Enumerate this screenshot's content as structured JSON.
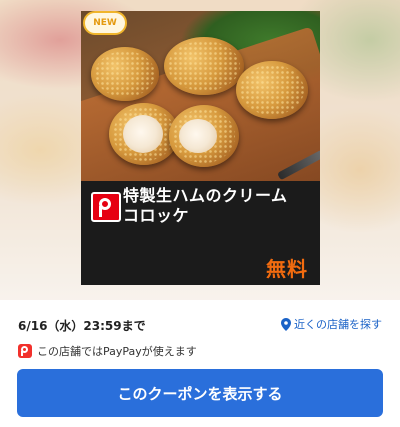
{
  "coupon": {
    "badge": "NEW",
    "title_line1": "特製生ハムのクリーム",
    "title_line2": "コロッケ",
    "price_label": "無料"
  },
  "info": {
    "deadline": "6/16（水）23:59まで",
    "nearby_link": "近くの店舗を探す",
    "paypay_text": "この店舗ではPayPayが使えます"
  },
  "action": {
    "show_button": "このクーポンを表示する"
  },
  "colors": {
    "accent_blue": "#2a6fdb",
    "link_blue": "#1a62c7",
    "price_orange": "#f26b0f",
    "paypay_red": "#f2312c"
  },
  "icons": [
    "map-pin-icon",
    "paypay-icon",
    "brand-p-logo"
  ]
}
